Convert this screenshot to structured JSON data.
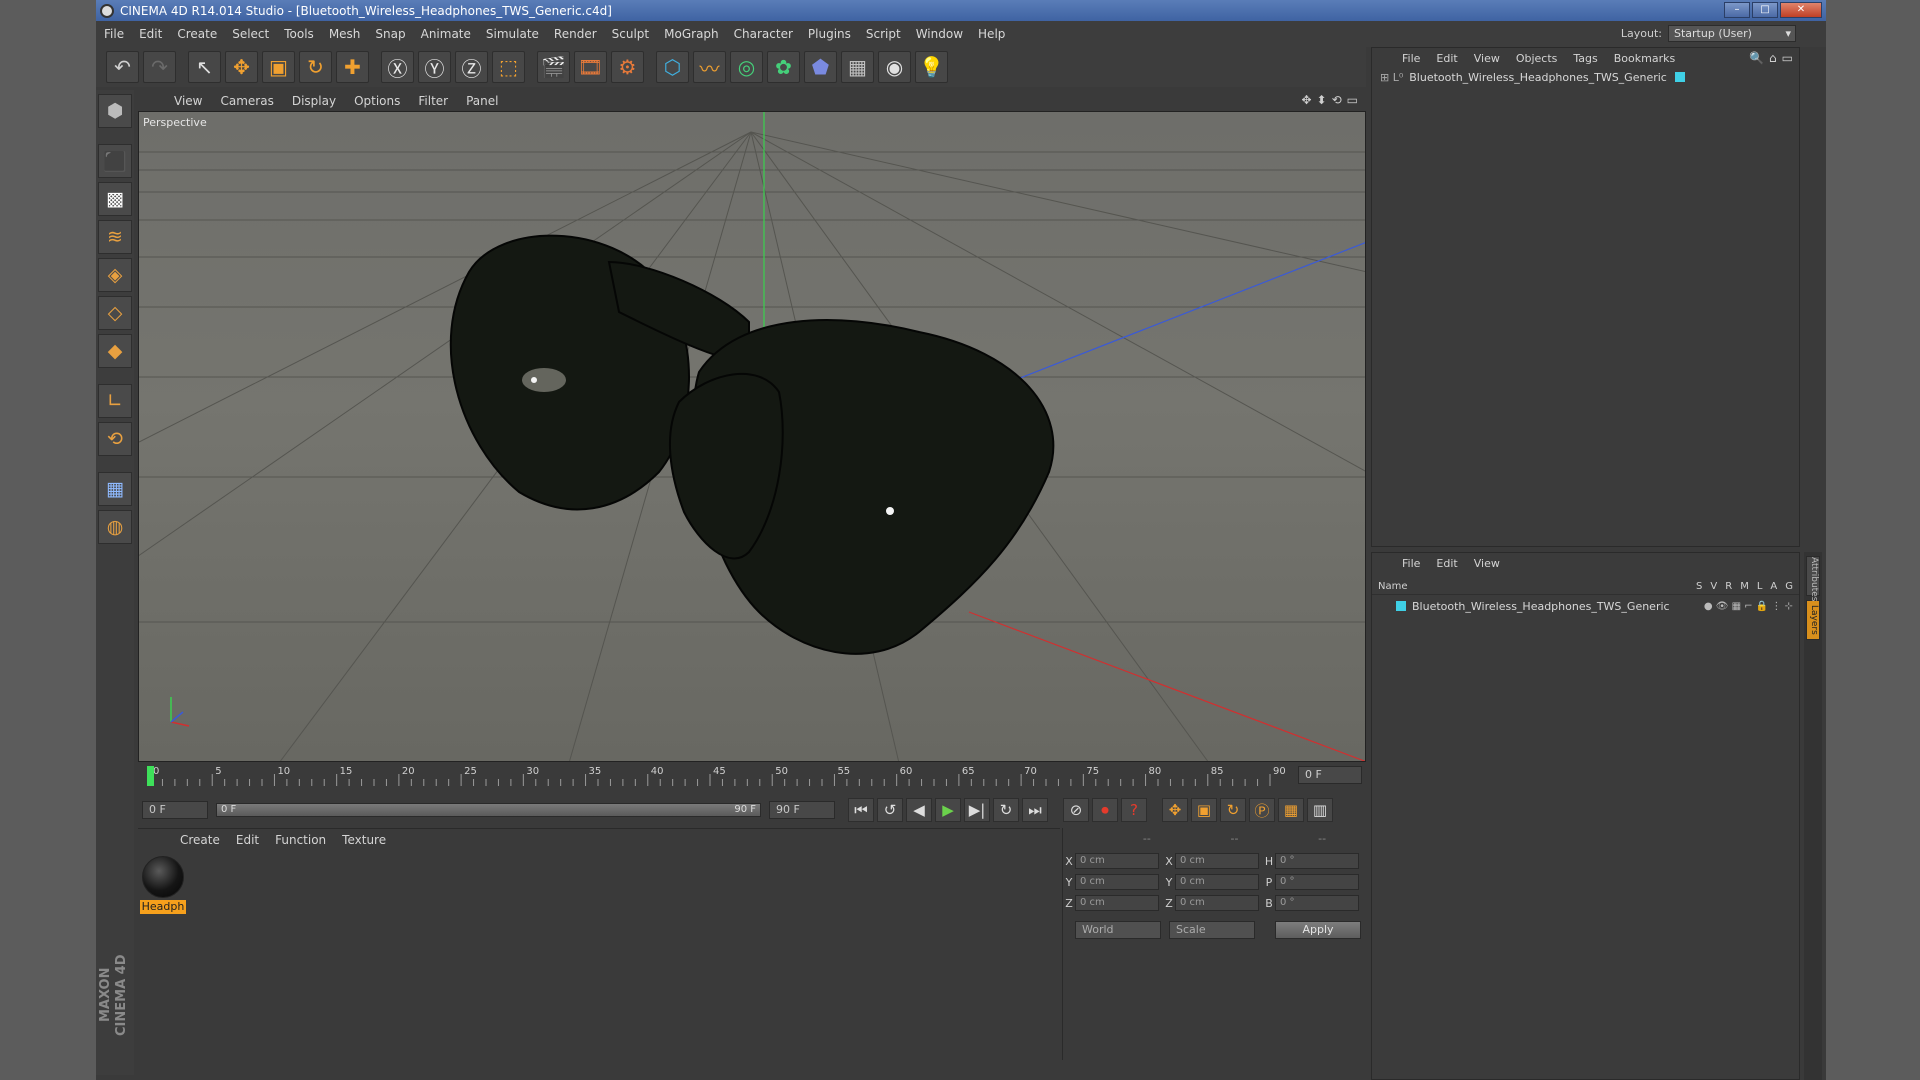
{
  "window": {
    "title": "CINEMA 4D R14.014 Studio - [Bluetooth_Wireless_Headphones_TWS_Generic.c4d]",
    "minimize_glyph": "–",
    "maximize_glyph": "□",
    "close_glyph": "✕"
  },
  "menu": [
    "File",
    "Edit",
    "Create",
    "Select",
    "Tools",
    "Mesh",
    "Snap",
    "Animate",
    "Simulate",
    "Render",
    "Sculpt",
    "MoGraph",
    "Character",
    "Plugins",
    "Script",
    "Window",
    "Help"
  ],
  "layout": {
    "label": "Layout:",
    "value": "Startup (User)"
  },
  "toolbar": {
    "icons": [
      "undo-icon",
      "redo-icon",
      "live-selection-icon",
      "move-icon",
      "scale-icon",
      "rotate-icon",
      "add-icon",
      "x-axis-icon",
      "y-axis-icon",
      "z-axis-icon",
      "coordinate-system-icon",
      "render-view-icon",
      "render-picture-viewer-icon",
      "edit-render-settings-icon",
      "cube-primitive-icon",
      "spline-pen-icon",
      "subdivision-surface-icon",
      "array-icon",
      "deformer-icon",
      "floor-icon",
      "camera-icon",
      "light-icon"
    ],
    "glyphs": [
      "↶",
      "↷",
      "↖",
      "✥",
      "▣",
      "↻",
      "✚",
      "Ⓧ",
      "Ⓨ",
      "Ⓩ",
      "⬚",
      "🎬",
      "🎞",
      "⚙",
      "⬡",
      "〰",
      "◎",
      "✿",
      "⬟",
      "▦",
      "◉",
      "💡"
    ],
    "colors": [
      "#d0d0d0",
      "#6a6a6a",
      "#e0e0e0",
      "#f0a030",
      "#f0a030",
      "#f0a030",
      "#f0a030",
      "#e8e8e8",
      "#e8e8e8",
      "#e8e8e8",
      "#f0a030",
      "#e8e8e8",
      "#e87a3a",
      "#e87a3a",
      "#40b0e0",
      "#f0a030",
      "#45d07a",
      "#45d07a",
      "#7a8ae0",
      "#c0c0c0",
      "#e0e0e0",
      "#e8e8c0"
    ]
  },
  "left_tools": {
    "icons": [
      "make-editable-icon",
      "model-mode-icon",
      "texture-mode-icon",
      "workplane-icon",
      "points-mode-icon",
      "edges-mode-icon",
      "polygons-mode-icon",
      "axis-icon",
      "magnet-icon",
      "snap-grid-icon",
      "snap-settings-icon"
    ],
    "glyphs": [
      "⬢",
      "⬛",
      "▩",
      "≋",
      "◈",
      "◇",
      "◆",
      "∟",
      "⟲",
      "▦",
      "◍"
    ],
    "colors": [
      "#bbbbbb",
      "#e8a040",
      "#ffffff",
      "#e8a040",
      "#e8a040",
      "#e8a040",
      "#e8a040",
      "#e8a040",
      "#e8a040",
      "#8fbaff",
      "#e8a040"
    ]
  },
  "brand": "MAXON CINEMA 4D",
  "viewport": {
    "menu": [
      "View",
      "Cameras",
      "Display",
      "Options",
      "Filter",
      "Panel"
    ],
    "label": "Perspective",
    "nav_icons": [
      "✥",
      "⬍",
      "⟲",
      "▭"
    ],
    "axes": {
      "y": "#3ad14e",
      "x": "#d03030",
      "z": "#3a5ad8"
    },
    "model_color": "#141812"
  },
  "timeline": {
    "ticks": [
      "0",
      "5",
      "10",
      "15",
      "20",
      "25",
      "30",
      "35",
      "40",
      "45",
      "50",
      "55",
      "60",
      "65",
      "70",
      "75",
      "80",
      "85",
      "90"
    ],
    "current_frame": "0 F"
  },
  "transport": {
    "start": "0 F",
    "range_start": "0 F",
    "range_end": "90 F",
    "end": "90 F",
    "buttons": [
      "go-to-start-icon",
      "previous-key-icon",
      "previous-frame-icon",
      "play-icon",
      "next-frame-icon",
      "next-key-icon",
      "go-to-end-icon",
      "record-keys-icon",
      "autokeying-icon",
      "key-settings-icon",
      "key-position-icon",
      "key-scale-icon",
      "key-rotation-icon",
      "key-parameter-icon",
      "key-pla-icon",
      "timeline-icon"
    ],
    "glyphs": [
      "⏮",
      "↺",
      "◀",
      "▶",
      "▶|",
      "↻",
      "⏭",
      "⊘",
      "⏺",
      "?",
      "✥",
      "▣",
      "↻",
      "Ⓟ",
      "▦",
      "▥"
    ]
  },
  "materials": {
    "menu": [
      "Create",
      "Edit",
      "Function",
      "Texture"
    ],
    "items": [
      {
        "label": "Headph"
      }
    ]
  },
  "coords": {
    "header": [
      "--",
      "--",
      "--"
    ],
    "rows": [
      {
        "a": "X",
        "av": "0 cm",
        "b": "X",
        "bv": "0 cm",
        "c": "H",
        "cv": "0 °"
      },
      {
        "a": "Y",
        "av": "0 cm",
        "b": "Y",
        "bv": "0 cm",
        "c": "P",
        "cv": "0 °"
      },
      {
        "a": "Z",
        "av": "0 cm",
        "b": "Z",
        "bv": "0 cm",
        "c": "B",
        "cv": "0 °"
      }
    ],
    "mode": "World",
    "transform": "Scale",
    "apply": "Apply"
  },
  "objects": {
    "menu": [
      "File",
      "Edit",
      "View",
      "Objects",
      "Tags",
      "Bookmarks"
    ],
    "items": [
      {
        "name": "Bluetooth_Wireless_Headphones_TWS_Generic",
        "color": "#3fd0e6"
      }
    ]
  },
  "layers": {
    "menu": [
      "File",
      "Edit",
      "View"
    ],
    "header_name": "Name",
    "cols": [
      "S",
      "V",
      "R",
      "M",
      "L",
      "A",
      "G"
    ],
    "items": [
      {
        "name": "Bluetooth_Wireless_Headphones_TWS_Generic",
        "color": "#3fd0e6"
      }
    ]
  },
  "side_tabs": [
    "Attributes",
    "Layers"
  ]
}
